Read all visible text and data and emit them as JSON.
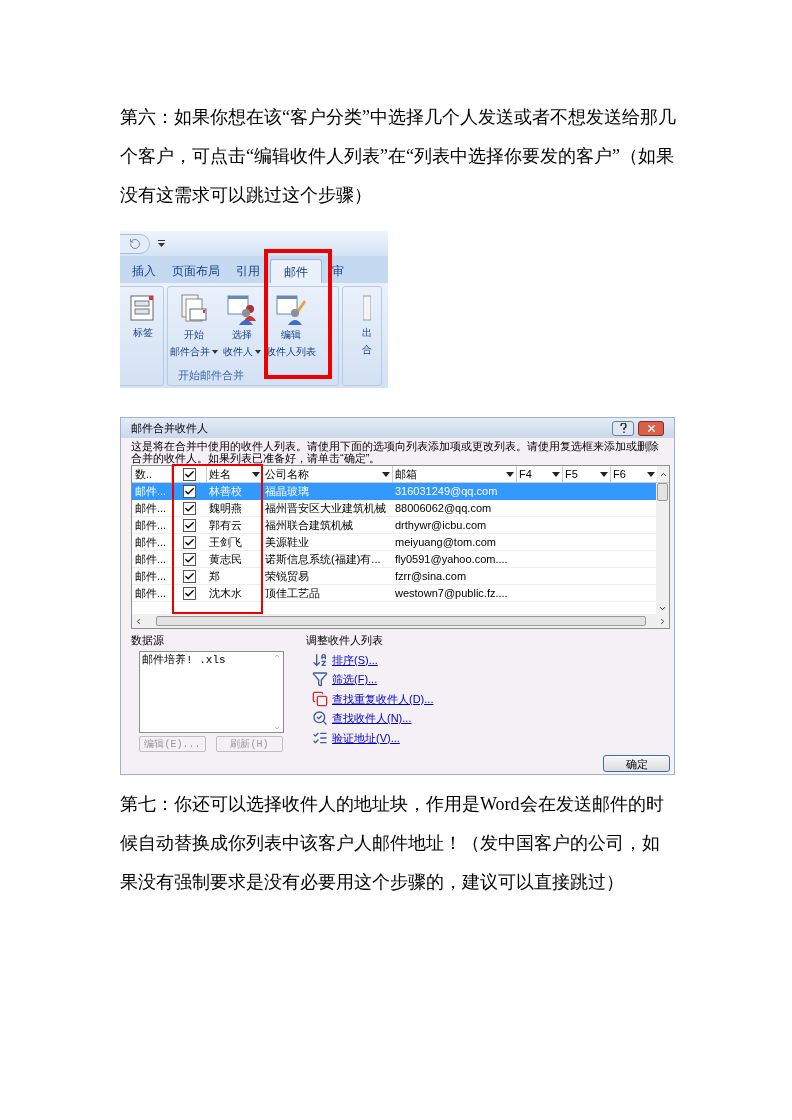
{
  "intro": "第六：如果你想在该“客户分类”中选择几个人发送或者不想发送给那几个客户，可点击“编辑收件人列表”在“列表中选择你要发的客户”（如果没有这需求可以跳过这个步骤）",
  "ribbon": {
    "tabs": [
      {
        "label": "插入",
        "selected": false
      },
      {
        "label": "页面布局",
        "selected": false
      },
      {
        "label": "引用",
        "selected": false
      },
      {
        "label": "邮件",
        "selected": true
      },
      {
        "label": "审",
        "selected": false
      }
    ],
    "buttons": [
      {
        "kind": "labels",
        "lines": [
          "标签"
        ],
        "dropdown": false
      },
      {
        "kind": "start",
        "lines": [
          "开始",
          "邮件合并"
        ],
        "dropdown": true
      },
      {
        "kind": "select",
        "lines": [
          "选择",
          "收件人"
        ],
        "dropdown": true
      },
      {
        "kind": "edit",
        "lines": [
          "编辑",
          "收件人列表"
        ],
        "dropdown": false
      },
      {
        "kind": "partial",
        "lines": [
          "出",
          "合"
        ],
        "dropdown": false
      }
    ],
    "group_label": "开始邮件合并"
  },
  "dialog": {
    "title": "邮件合并收件人",
    "description": "这是将在合并中使用的收件人列表。请使用下面的选项向列表添加项或更改列表。请使用复选框来添加或删除合并的收件人。如果列表已准备好，请单击“确定”。",
    "columns": [
      "数..",
      "姓名",
      "公司名称",
      "邮箱",
      "F4",
      "F5",
      "F6"
    ],
    "all_checked": true,
    "rows": [
      {
        "source": "邮件...",
        "checked": true,
        "name": "林善校",
        "company": "福晶玻璃",
        "email": "316031249@qq.com",
        "selected": true
      },
      {
        "source": "邮件...",
        "checked": true,
        "name": "魏明燕",
        "company": "福州晋安区大业建筑机械",
        "email": "88006062@qq.com",
        "selected": false
      },
      {
        "source": "邮件...",
        "checked": true,
        "name": "郭有云",
        "company": "福州联合建筑机械",
        "email": "drthywr@icbu.com",
        "selected": false
      },
      {
        "source": "邮件...",
        "checked": true,
        "name": "王剑飞",
        "company": "美源鞋业",
        "email": "meiyuang@tom.com",
        "selected": false
      },
      {
        "source": "邮件...",
        "checked": true,
        "name": "黄志民",
        "company": "诺斯信息系统(福建)有...",
        "email": "fly0591@yahoo.com....",
        "selected": false
      },
      {
        "source": "邮件...",
        "checked": true,
        "name": "郑",
        "company": "荣锐贸易",
        "email": "fzrr@sina.com",
        "selected": false
      },
      {
        "source": "邮件...",
        "checked": true,
        "name": "沈木水",
        "company": "顶佳工艺品",
        "email": "westown7@public.fz....",
        "selected": false
      }
    ],
    "data_source": {
      "label": "数据源",
      "items": [
        "邮件培养! .xls"
      ],
      "buttons": [
        {
          "label": "编辑(E)...",
          "disabled": true
        },
        {
          "label": "刷新(H)",
          "disabled": true
        }
      ]
    },
    "adjust": {
      "label": "调整收件人列表",
      "links": [
        {
          "kind": "sort",
          "label": "排序(S)..."
        },
        {
          "kind": "filter",
          "label": "筛选(F)..."
        },
        {
          "kind": "duplicates",
          "label": "查找重复收件人(D)..."
        },
        {
          "kind": "find",
          "label": "查找收件人(N)..."
        },
        {
          "kind": "validate",
          "label": "验证地址(V)..."
        }
      ]
    },
    "ok_button": "确定"
  },
  "note": "第七：你还可以选择收件人的地址块，作用是Word会在发送邮件的时候自动替换成你列表中该客户人邮件地址！（发中国客户的公司，如果没有强制要求是没有必要用这个步骤的，建议可以直接跳过）"
}
